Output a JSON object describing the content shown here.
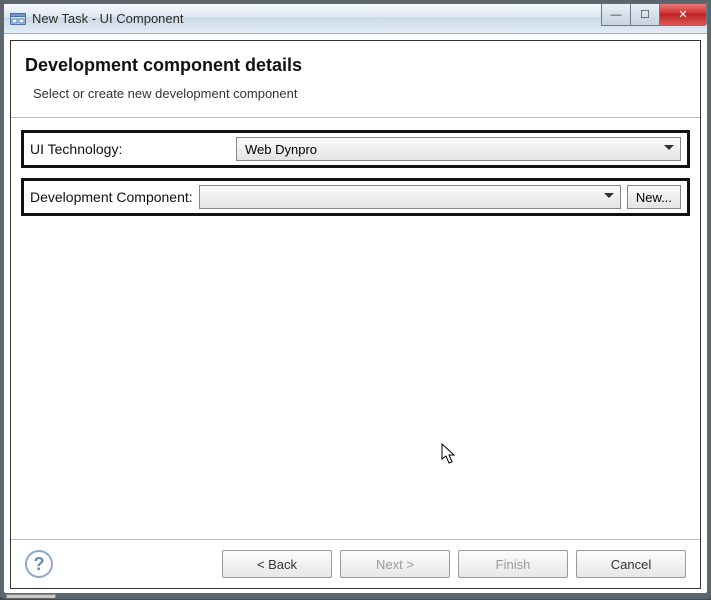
{
  "window": {
    "title": "New Task - UI Component"
  },
  "win_controls": {
    "minimize": "—",
    "maximize": "☐",
    "close": "✕"
  },
  "header": {
    "title": "Development component details",
    "subtitle": "Select or create new development component"
  },
  "form": {
    "ui_tech_label": "UI Technology:",
    "ui_tech_value": "Web Dynpro",
    "dev_comp_label": "Development Component:",
    "dev_comp_value": "",
    "new_button": "New..."
  },
  "buttons": {
    "help": "?",
    "back": "< Back",
    "next": "Next >",
    "finish": "Finish",
    "cancel": "Cancel"
  }
}
